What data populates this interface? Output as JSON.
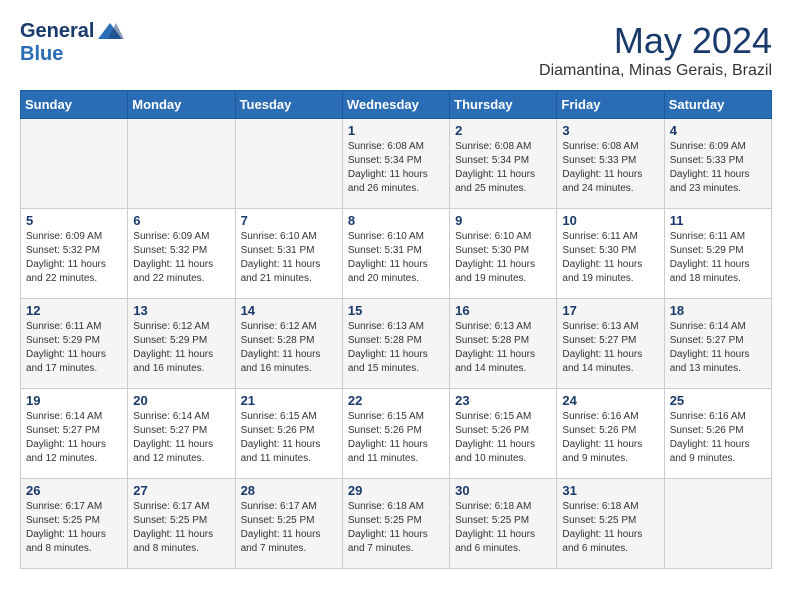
{
  "header": {
    "logo_line1": "General",
    "logo_line2": "Blue",
    "month_year": "May 2024",
    "location": "Diamantina, Minas Gerais, Brazil"
  },
  "weekdays": [
    "Sunday",
    "Monday",
    "Tuesday",
    "Wednesday",
    "Thursday",
    "Friday",
    "Saturday"
  ],
  "weeks": [
    [
      {
        "day": "",
        "info": ""
      },
      {
        "day": "",
        "info": ""
      },
      {
        "day": "",
        "info": ""
      },
      {
        "day": "1",
        "info": "Sunrise: 6:08 AM\nSunset: 5:34 PM\nDaylight: 11 hours and 26 minutes."
      },
      {
        "day": "2",
        "info": "Sunrise: 6:08 AM\nSunset: 5:34 PM\nDaylight: 11 hours and 25 minutes."
      },
      {
        "day": "3",
        "info": "Sunrise: 6:08 AM\nSunset: 5:33 PM\nDaylight: 11 hours and 24 minutes."
      },
      {
        "day": "4",
        "info": "Sunrise: 6:09 AM\nSunset: 5:33 PM\nDaylight: 11 hours and 23 minutes."
      }
    ],
    [
      {
        "day": "5",
        "info": "Sunrise: 6:09 AM\nSunset: 5:32 PM\nDaylight: 11 hours and 22 minutes."
      },
      {
        "day": "6",
        "info": "Sunrise: 6:09 AM\nSunset: 5:32 PM\nDaylight: 11 hours and 22 minutes."
      },
      {
        "day": "7",
        "info": "Sunrise: 6:10 AM\nSunset: 5:31 PM\nDaylight: 11 hours and 21 minutes."
      },
      {
        "day": "8",
        "info": "Sunrise: 6:10 AM\nSunset: 5:31 PM\nDaylight: 11 hours and 20 minutes."
      },
      {
        "day": "9",
        "info": "Sunrise: 6:10 AM\nSunset: 5:30 PM\nDaylight: 11 hours and 19 minutes."
      },
      {
        "day": "10",
        "info": "Sunrise: 6:11 AM\nSunset: 5:30 PM\nDaylight: 11 hours and 19 minutes."
      },
      {
        "day": "11",
        "info": "Sunrise: 6:11 AM\nSunset: 5:29 PM\nDaylight: 11 hours and 18 minutes."
      }
    ],
    [
      {
        "day": "12",
        "info": "Sunrise: 6:11 AM\nSunset: 5:29 PM\nDaylight: 11 hours and 17 minutes."
      },
      {
        "day": "13",
        "info": "Sunrise: 6:12 AM\nSunset: 5:29 PM\nDaylight: 11 hours and 16 minutes."
      },
      {
        "day": "14",
        "info": "Sunrise: 6:12 AM\nSunset: 5:28 PM\nDaylight: 11 hours and 16 minutes."
      },
      {
        "day": "15",
        "info": "Sunrise: 6:13 AM\nSunset: 5:28 PM\nDaylight: 11 hours and 15 minutes."
      },
      {
        "day": "16",
        "info": "Sunrise: 6:13 AM\nSunset: 5:28 PM\nDaylight: 11 hours and 14 minutes."
      },
      {
        "day": "17",
        "info": "Sunrise: 6:13 AM\nSunset: 5:27 PM\nDaylight: 11 hours and 14 minutes."
      },
      {
        "day": "18",
        "info": "Sunrise: 6:14 AM\nSunset: 5:27 PM\nDaylight: 11 hours and 13 minutes."
      }
    ],
    [
      {
        "day": "19",
        "info": "Sunrise: 6:14 AM\nSunset: 5:27 PM\nDaylight: 11 hours and 12 minutes."
      },
      {
        "day": "20",
        "info": "Sunrise: 6:14 AM\nSunset: 5:27 PM\nDaylight: 11 hours and 12 minutes."
      },
      {
        "day": "21",
        "info": "Sunrise: 6:15 AM\nSunset: 5:26 PM\nDaylight: 11 hours and 11 minutes."
      },
      {
        "day": "22",
        "info": "Sunrise: 6:15 AM\nSunset: 5:26 PM\nDaylight: 11 hours and 11 minutes."
      },
      {
        "day": "23",
        "info": "Sunrise: 6:15 AM\nSunset: 5:26 PM\nDaylight: 11 hours and 10 minutes."
      },
      {
        "day": "24",
        "info": "Sunrise: 6:16 AM\nSunset: 5:26 PM\nDaylight: 11 hours and 9 minutes."
      },
      {
        "day": "25",
        "info": "Sunrise: 6:16 AM\nSunset: 5:26 PM\nDaylight: 11 hours and 9 minutes."
      }
    ],
    [
      {
        "day": "26",
        "info": "Sunrise: 6:17 AM\nSunset: 5:25 PM\nDaylight: 11 hours and 8 minutes."
      },
      {
        "day": "27",
        "info": "Sunrise: 6:17 AM\nSunset: 5:25 PM\nDaylight: 11 hours and 8 minutes."
      },
      {
        "day": "28",
        "info": "Sunrise: 6:17 AM\nSunset: 5:25 PM\nDaylight: 11 hours and 7 minutes."
      },
      {
        "day": "29",
        "info": "Sunrise: 6:18 AM\nSunset: 5:25 PM\nDaylight: 11 hours and 7 minutes."
      },
      {
        "day": "30",
        "info": "Sunrise: 6:18 AM\nSunset: 5:25 PM\nDaylight: 11 hours and 6 minutes."
      },
      {
        "day": "31",
        "info": "Sunrise: 6:18 AM\nSunset: 5:25 PM\nDaylight: 11 hours and 6 minutes."
      },
      {
        "day": "",
        "info": ""
      }
    ]
  ]
}
